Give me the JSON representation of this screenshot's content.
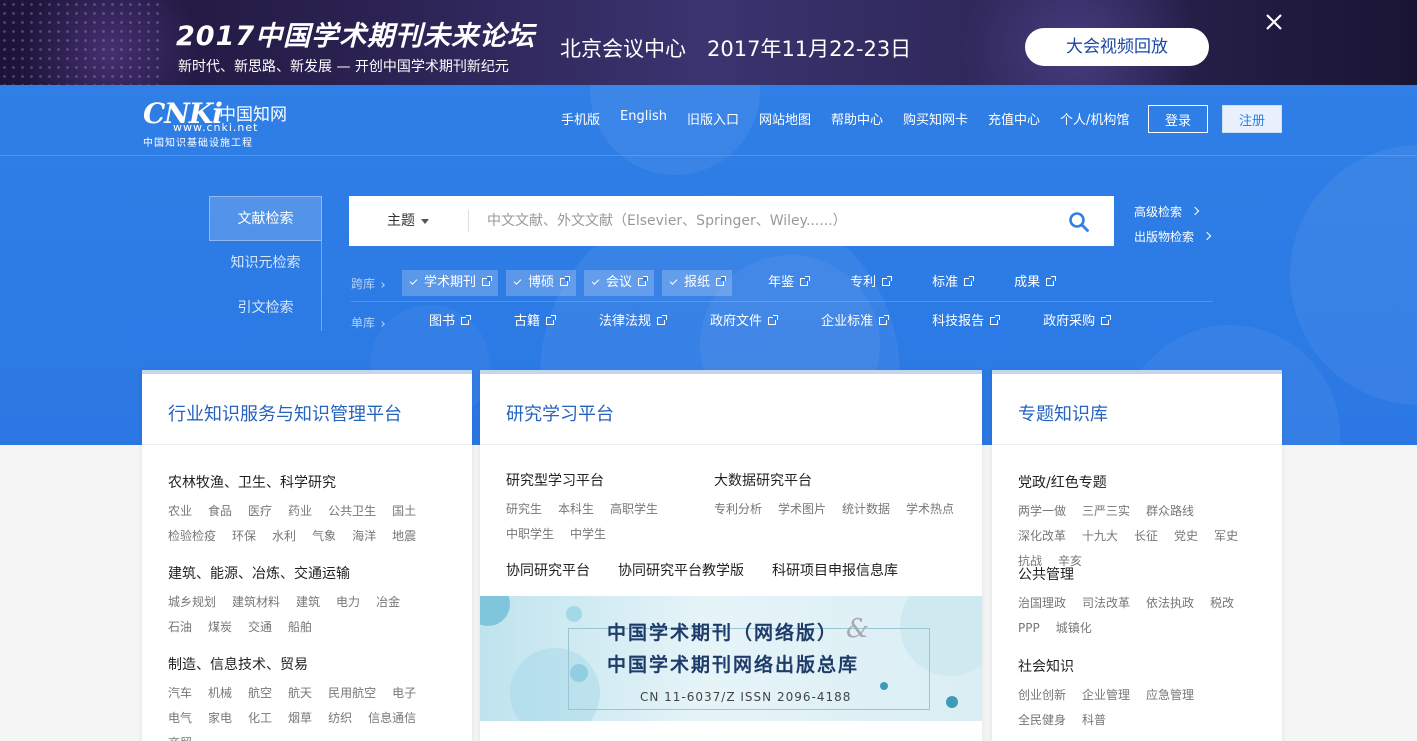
{
  "banner": {
    "title": "2017中国学术期刊未来论坛",
    "subtitle": "新时代、新思路、新发展 — 开创中国学术期刊新纪元",
    "venue": "北京会议中心　2017年11月22-23日",
    "video_button": "大会视频回放",
    "close_icon": "close-icon"
  },
  "logo": {
    "brand": "CNKi",
    "cn_name": "中国知网",
    "url": "www.cnki.net",
    "slogan": "中国知识基础设施工程"
  },
  "topnav": [
    "手机版",
    "English",
    "旧版入口",
    "网站地图",
    "帮助中心",
    "购买知网卡",
    "充值中心",
    "个人/机构馆"
  ],
  "auth": {
    "login": "登录",
    "register": "注册"
  },
  "search": {
    "tabs": [
      "文献检索",
      "知识元检索",
      "引文检索"
    ],
    "field": "主题",
    "placeholder": "中文文献、外文文献（Elsevier、Springer、Wiley......）",
    "value": "",
    "advanced": "高级检索",
    "publication": "出版物检索"
  },
  "databases": {
    "cross_label": "跨库",
    "cross": [
      {
        "name": "学术期刊",
        "checked": true
      },
      {
        "name": "博硕",
        "checked": true
      },
      {
        "name": "会议",
        "checked": true
      },
      {
        "name": "报纸",
        "checked": true
      },
      {
        "name": "年鉴",
        "checked": false
      },
      {
        "name": "专利",
        "checked": false
      },
      {
        "name": "标准",
        "checked": false
      },
      {
        "name": "成果",
        "checked": false
      }
    ],
    "single_label": "单库",
    "single": [
      "图书",
      "古籍",
      "法律法规",
      "政府文件",
      "企业标准",
      "科技报告",
      "政府采购"
    ]
  },
  "industry": {
    "title": "行业知识服务与知识管理平台",
    "groups": [
      {
        "title": "农林牧渔、卫生、科学研究",
        "tags": [
          "农业",
          "食品",
          "医疗",
          "药业",
          "公共卫生",
          "国土",
          "检验检疫",
          "环保",
          "水利",
          "气象",
          "海洋",
          "地震"
        ]
      },
      {
        "title": "建筑、能源、冶炼、交通运输",
        "tags": [
          "城乡规划",
          "建筑材料",
          "建筑",
          "电力",
          "冶金",
          "石油",
          "煤炭",
          "交通",
          "船舶"
        ]
      },
      {
        "title": "制造、信息技术、贸易",
        "tags": [
          "汽车",
          "机械",
          "航空",
          "航天",
          "民用航空",
          "电子",
          "电气",
          "家电",
          "化工",
          "烟草",
          "纺织",
          "信息通信",
          "商贸"
        ]
      }
    ]
  },
  "research": {
    "title": "研究学习平台",
    "groups": [
      {
        "title": "研究型学习平台",
        "tags": [
          "研究生",
          "本科生",
          "高职学生",
          "中职学生",
          "中学生"
        ]
      },
      {
        "title": "大数据研究平台",
        "tags": [
          "专利分析",
          "学术图片",
          "统计数据",
          "学术热点"
        ]
      }
    ],
    "links": [
      "协同研究平台",
      "协同研究平台教学版",
      "科研项目申报信息库"
    ],
    "banner": {
      "line1": "中国学术期刊（网络版）",
      "amp": "&",
      "line2": "中国学术期刊网络出版总库",
      "issn": "CN  11-6037/Z      ISSN  2096-4188"
    }
  },
  "topic": {
    "title": "专题知识库",
    "groups": [
      {
        "title": "党政/红色专题",
        "tags": [
          "两学一做",
          "三严三实",
          "群众路线",
          "深化改革",
          "十九大",
          "长征",
          "党史",
          "军史",
          "抗战",
          "辛亥"
        ]
      },
      {
        "title": "公共管理",
        "tags": [
          "治国理政",
          "司法改革",
          "依法执政",
          "税改",
          "PPP",
          "城镇化"
        ]
      },
      {
        "title": "社会知识",
        "tags": [
          "创业创新",
          "企业管理",
          "应急管理",
          "全民健身",
          "科普"
        ]
      }
    ]
  },
  "colors": {
    "primary": "#2f7fe6",
    "title_blue": "#2563c0",
    "banner_bg": "#2a2150"
  }
}
